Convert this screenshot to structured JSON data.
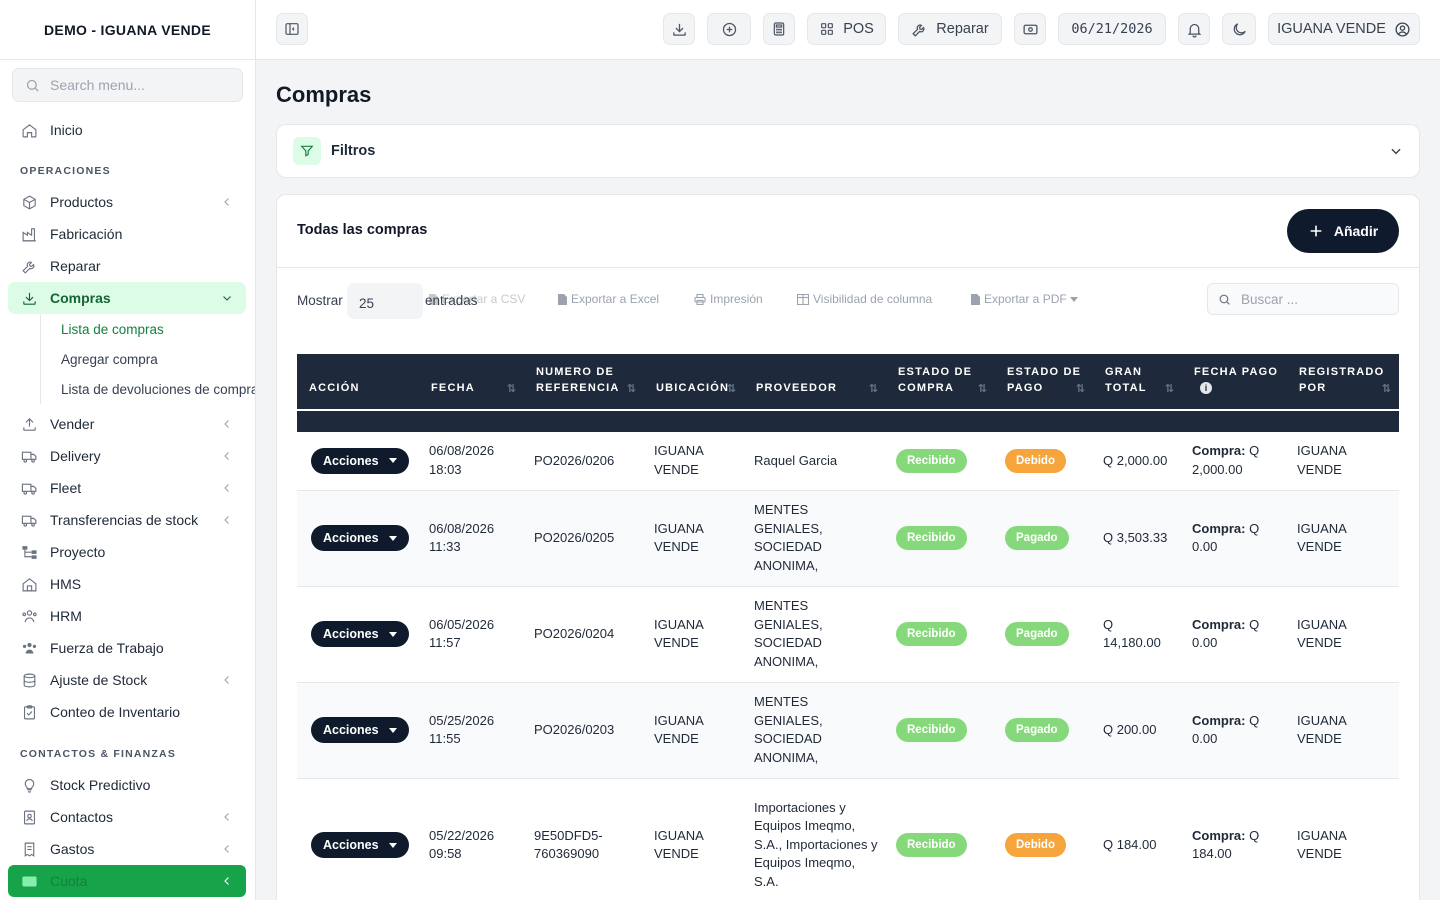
{
  "sidebar": {
    "brand": "DEMO - IGUANA VENDE",
    "search_placeholder": "Search menu...",
    "home": "Inicio",
    "section_ops": "OPERACIONES",
    "ops": [
      {
        "label": "Productos"
      },
      {
        "label": "Fabricación"
      },
      {
        "label": "Reparar"
      },
      {
        "label": "Compras"
      },
      {
        "label": "Vender"
      },
      {
        "label": "Delivery"
      },
      {
        "label": "Fleet"
      },
      {
        "label": "Transferencias de stock"
      },
      {
        "label": "Proyecto"
      },
      {
        "label": "HMS"
      },
      {
        "label": "HRM"
      },
      {
        "label": "Fuerza de Trabajo"
      },
      {
        "label": "Ajuste de Stock"
      },
      {
        "label": "Conteo de Inventario"
      }
    ],
    "compras_sub": [
      "Lista de compras",
      "Agregar compra",
      "Lista de devoluciones de compra"
    ],
    "section_contacts": "CONTACTOS & FINANZAS",
    "contacts": [
      {
        "label": "Stock Predictivo"
      },
      {
        "label": "Contactos"
      },
      {
        "label": "Gastos"
      },
      {
        "label": "Cuota"
      }
    ]
  },
  "topbar": {
    "pos_label": "POS",
    "repair_label": "Reparar",
    "date": "06/21/2026",
    "user": "IGUANA VENDE"
  },
  "page": {
    "title": "Compras",
    "filters_label": "Filtros",
    "card_title": "Todas las compras",
    "add_label": "Añadir",
    "show_label": "Mostrar",
    "page_length": "25",
    "entries_label": "entradas",
    "export_csv": "Exportar a CSV",
    "export_excel": "Exportar a Excel",
    "print": "Impresión",
    "col_visibility": "Visibilidad de columna",
    "export_pdf": "Exportar a PDF",
    "search_placeholder": "Buscar ..."
  },
  "table": {
    "headers": {
      "accion": "ACCIÓN",
      "fecha": "FECHA",
      "ref": "NUMERO DE REFERENCIA",
      "ubicacion": "UBICACIÓN",
      "proveedor": "PROVEEDOR",
      "estado_compra": "ESTADO DE COMPRA",
      "estado_pago": "ESTADO DE PAGO",
      "gran_total": "GRAN TOTAL",
      "fecha_pago": "FECHA PAGO",
      "registrado": "REGISTRADO POR"
    },
    "action_label": "Acciones",
    "pay_prefix": "Compra:",
    "rows": [
      {
        "fecha": "06/08/2026 18:03",
        "ref": "PO2026/0206",
        "ubicacion": "IGUANA VENDE",
        "proveedor": "Raquel Garcia",
        "estado_compra": "Recibido",
        "estado_pago": "Debido",
        "pago_color": "#f6a43c",
        "total": "Q 2,000.00",
        "pago_monto": "Q 2,000.00",
        "registrado": "IGUANA VENDE"
      },
      {
        "fecha": "06/08/2026 11:33",
        "ref": "PO2026/0205",
        "ubicacion": "IGUANA VENDE",
        "proveedor": "MENTES GENIALES, SOCIEDAD ANONIMA,",
        "estado_compra": "Recibido",
        "estado_pago": "Pagado",
        "pago_color": "#86d97b",
        "total": "Q 3,503.33",
        "pago_monto": "Q 0.00",
        "registrado": "IGUANA VENDE"
      },
      {
        "fecha": "06/05/2026 11:57",
        "ref": "PO2026/0204",
        "ubicacion": "IGUANA VENDE",
        "proveedor": "MENTES GENIALES, SOCIEDAD ANONIMA,",
        "estado_compra": "Recibido",
        "estado_pago": "Pagado",
        "pago_color": "#86d97b",
        "total": "Q 14,180.00",
        "pago_monto": "Q 0.00",
        "registrado": "IGUANA VENDE"
      },
      {
        "fecha": "05/25/2026 11:55",
        "ref": "PO2026/0203",
        "ubicacion": "IGUANA VENDE",
        "proveedor": "MENTES GENIALES, SOCIEDAD ANONIMA,",
        "estado_compra": "Recibido",
        "estado_pago": "Pagado",
        "pago_color": "#86d97b",
        "total": "Q 200.00",
        "pago_monto": "Q 0.00",
        "registrado": "IGUANA VENDE"
      },
      {
        "fecha": "05/22/2026 09:58",
        "ref": "9E50DFD5-760369090",
        "ubicacion": "IGUANA VENDE",
        "proveedor": "Importaciones y Equipos Imeqmo, S.A., Importaciones y Equipos Imeqmo, S.A.",
        "estado_compra": "Recibido",
        "estado_pago": "Debido",
        "pago_color": "#f6a43c",
        "total": "Q 184.00",
        "pago_monto": "Q 184.00",
        "registrado": "IGUANA VENDE"
      }
    ]
  },
  "colors": {
    "accent_green": "#16a34a",
    "active_bg": "#dcfce7",
    "dark_navy": "#0f1b2d",
    "table_header": "#1e293b",
    "badge_received": "#86d97b",
    "badge_due": "#f6a43c"
  }
}
